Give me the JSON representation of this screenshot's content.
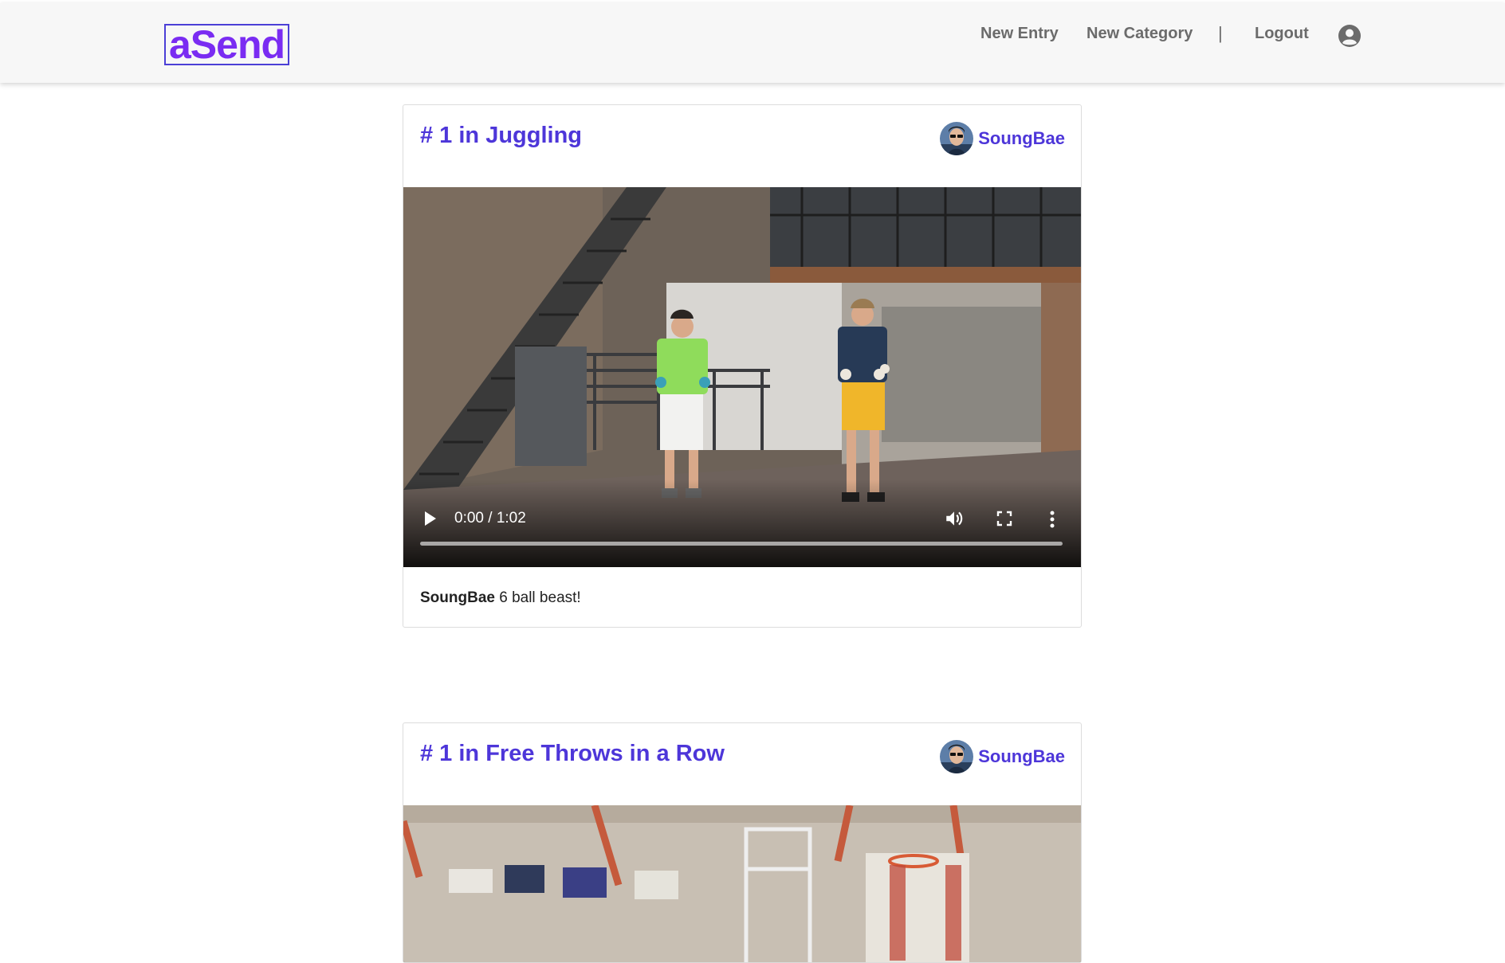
{
  "navbar": {
    "logo": "aSend",
    "links": [
      "New Entry",
      "New Category"
    ],
    "separator": "|",
    "logout": "Logout",
    "profile_icon": "user-circle-icon"
  },
  "posts": [
    {
      "title": "# 1 in Juggling",
      "author": "SoungBae",
      "video": {
        "time": "0:00 / 1:02",
        "progress": 0
      },
      "caption_author": "SoungBae",
      "caption_text": "6 ball beast!"
    },
    {
      "title": "# 1 in Free Throws in a Row",
      "author": "SoungBae"
    }
  ],
  "colors": {
    "accent": "#4d36d9",
    "logo": "#7a2cf2",
    "nav_text": "#6b6b6b"
  }
}
